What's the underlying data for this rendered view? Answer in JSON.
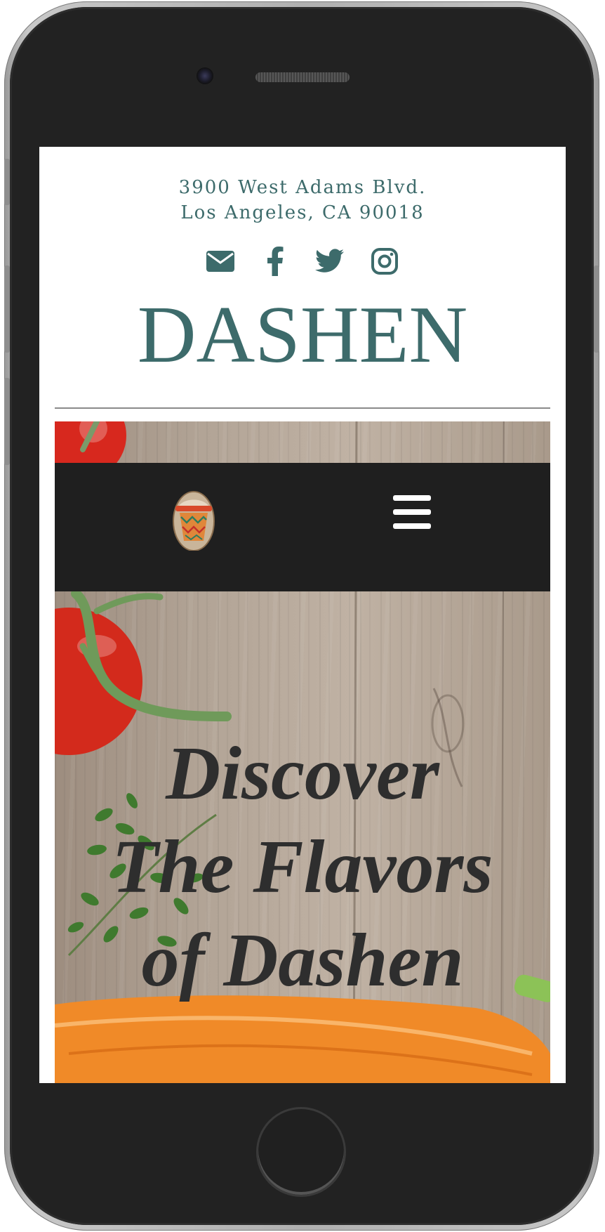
{
  "header": {
    "address_line1": "3900 West Adams Blvd.",
    "address_line2": "Los Angeles, CA 90018",
    "brand": "DASHEN"
  },
  "social_links": [
    {
      "icon": "envelope-icon",
      "label": "Email"
    },
    {
      "icon": "facebook-icon",
      "label": "Facebook"
    },
    {
      "icon": "twitter-icon",
      "label": "Twitter"
    },
    {
      "icon": "instagram-icon",
      "label": "Instagram"
    }
  ],
  "navbar": {
    "logo_icon": "mesob-basket-logo",
    "menu_icon": "hamburger-menu-icon"
  },
  "hero": {
    "tagline_line1": "Discover",
    "tagline_line2": "The Flavors",
    "tagline_line3": "of Dashen"
  },
  "colors": {
    "brand_teal": "#3d6b6b",
    "navbar_bg": "#1f1f1f",
    "tagline": "#2e2e2e",
    "phone_frame": "#222222"
  }
}
